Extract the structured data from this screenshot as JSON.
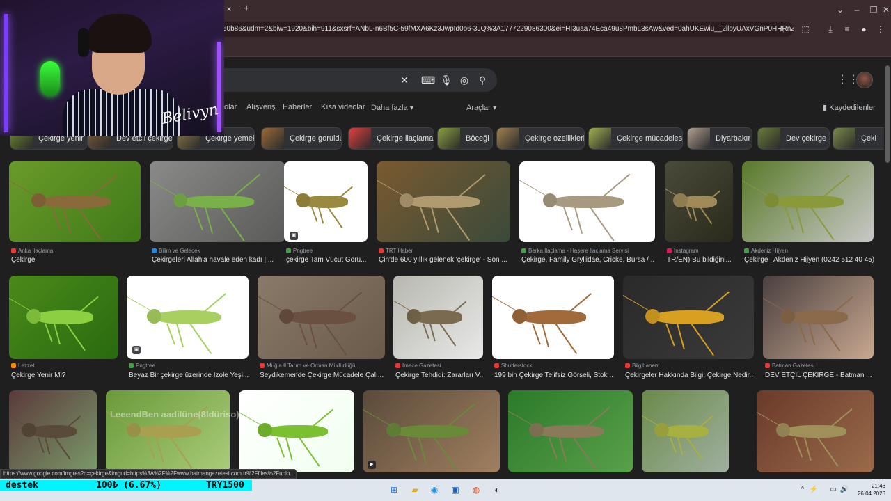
{
  "browser": {
    "url": "60b86&udm=2&biw=1920&bih=911&sxsrf=ANbL-n6Bf5C-59fMXA6Kz3JwpId0o6-3JQ%3A1777229086300&ei=HI3uaa74Eca49u8PmbL3sAw&ved=0ahUKEwiu__2iloyUAxVGnP0HHRnZHcYQ...",
    "tab_close": "×",
    "new_tab": "+",
    "status_url": "https://www.google.com/imgres?q=çekirge&imgurl=https%3A%2F%2Fwww.batmangazetesi.com.tr%2Ffiles%2Fuplo..."
  },
  "search": {
    "query": "",
    "nav_tabs": [
      "olar",
      "Alışveriş",
      "Haberler",
      "Kısa videolar",
      "Daha fazla",
      "Araçlar"
    ],
    "saved_label": "Kaydedilenler"
  },
  "chips": [
    {
      "label": "Çekirge yenir",
      "color": "#6b8a2a"
    },
    {
      "label": "Dev etcil çekirge",
      "color": "#7a5a3a"
    },
    {
      "label": "Çekirge yemek",
      "color": "#8a7a4a"
    },
    {
      "label": "Çekirge goruldu",
      "color": "#9a6a3a"
    },
    {
      "label": "Çekirge ilaçlama",
      "color": "#e04040"
    },
    {
      "label": "Böceği",
      "color": "#8aa040"
    },
    {
      "label": "Çekirge ozellikleri",
      "color": "#a08050"
    },
    {
      "label": "Çekirge mücadelesi",
      "color": "#a0b050"
    },
    {
      "label": "Diyarbakır",
      "color": "#b0a090"
    },
    {
      "label": "Dev çekirge",
      "color": "#6a7a3a"
    },
    {
      "label": "Çeki",
      "color": "#7a8a4a"
    }
  ],
  "results_row1": [
    {
      "source": "Anka İlaçlama",
      "title": "Çekirge",
      "fav": "#e53935"
    },
    {
      "source": "Bilim ve Gelecek",
      "title": "Çekirgeleri Allah'a havale eden kadı | ...",
      "fav": "#1e88e5"
    },
    {
      "source": "Pngtree",
      "title": "çekirge Tam Vücut Görü...",
      "fav": "#43a047"
    },
    {
      "source": "TRT Haber",
      "title": "Çin'de 600 yıllık gelenek 'çekirge' - Son ...",
      "fav": "#e53935"
    },
    {
      "source": "Berka İlaçlama - Haşere İlaçlama Servisi",
      "title": "Çekirge, Family Gryllidae, Cricke, Bursa / ...",
      "fav": "#43a047"
    },
    {
      "source": "Instagram",
      "title": "TR/EN) Bu bildiğini...",
      "fav": "#d81b60"
    },
    {
      "source": "Akdeniz Hijyen",
      "title": "Çekirge | Akdeniz Hijyen (0242 512 40 45)",
      "fav": "#43a047"
    }
  ],
  "results_row2": [
    {
      "source": "Lezzet",
      "title": "Çekirge Yenir Mi?",
      "fav": "#fb8c00"
    },
    {
      "source": "Pngtree",
      "title": "Beyaz Bir çekirge üzerinde Izole Yeşi...",
      "fav": "#43a047"
    },
    {
      "source": "Muğla İl Tarım ve Orman Müdürlüğü",
      "title": "Seydikemer'de Çekirge Mücadele Çalı...",
      "fav": "#e53935"
    },
    {
      "source": "İmece Gazetesi",
      "title": "Çekirge Tehdidi: Zararları V...",
      "fav": "#e53935"
    },
    {
      "source": "Shutterstock",
      "title": "199 bin Çekirge Telifsiz Görseli, Stok ...",
      "fav": "#e53935"
    },
    {
      "source": "Bilgihanem",
      "title": "Çekirgeler Hakkında Bilgi; Çekirge Nedir...",
      "fav": "#e53935"
    },
    {
      "source": "Batman Gazetesi",
      "title": "DEV ETÇİL ÇEKİRGE - Batman ...",
      "fav": "#e53935"
    }
  ],
  "overlay": {
    "signature": "Belivyn",
    "watermark": "LeeendBen  aadilüne(8ldüriso)"
  },
  "stream": {
    "label": "destek",
    "amount": "100₺ (6.67%)",
    "goal": "TRY1500"
  },
  "clock": {
    "time": "21:46",
    "date": "26.04.2026"
  }
}
